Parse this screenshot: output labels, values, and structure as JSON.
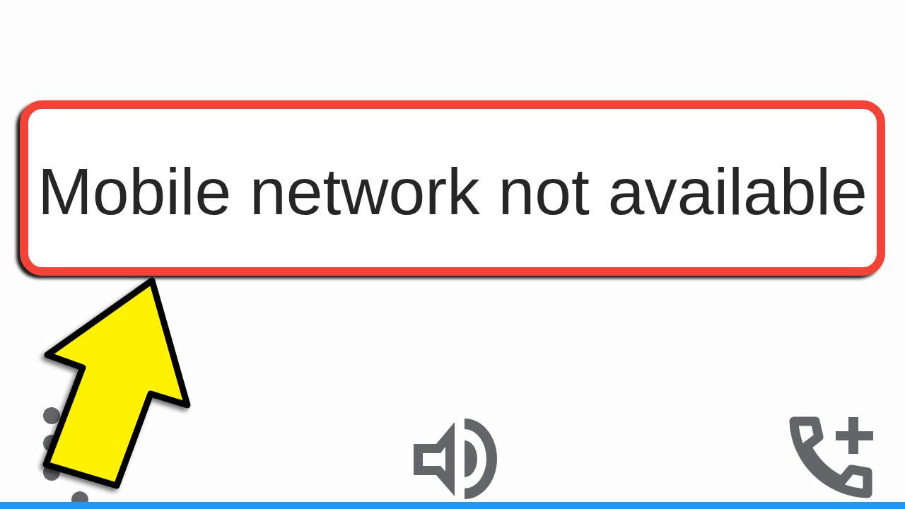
{
  "call_screen": {
    "status_message": "Mobile network not available"
  }
}
